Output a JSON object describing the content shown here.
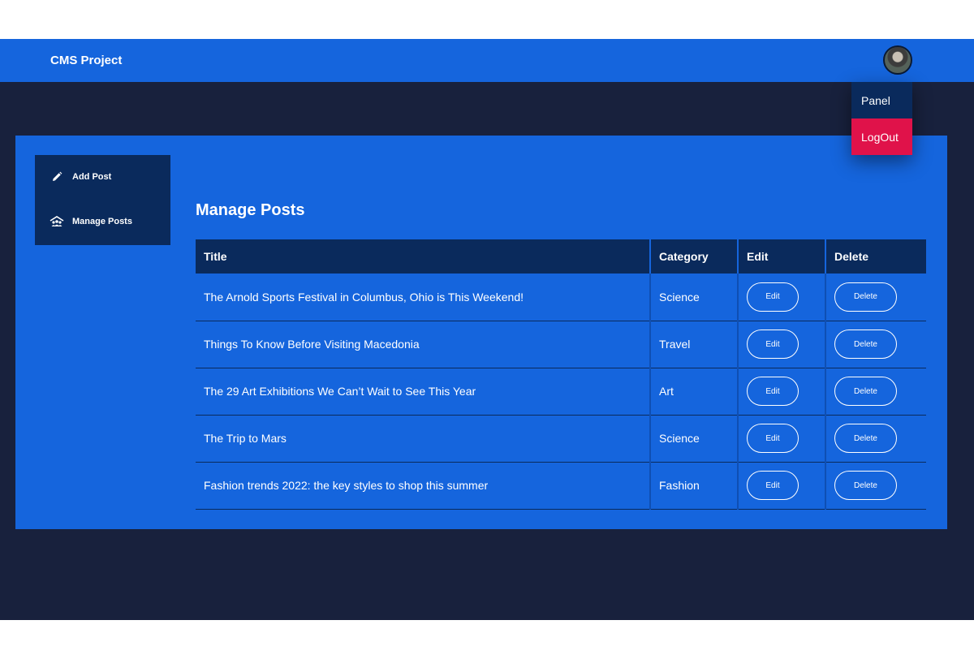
{
  "navbar": {
    "brand": "CMS Project",
    "avatar_icon": "user-avatar-icon"
  },
  "dropdown": {
    "panel_label": "Panel",
    "logout_label": "LogOut"
  },
  "sidebar": {
    "items": [
      {
        "label": "Add Post",
        "icon": "pencil-icon"
      },
      {
        "label": "Manage Posts",
        "icon": "manage-posts-icon"
      }
    ]
  },
  "main": {
    "heading": "Manage Posts",
    "table": {
      "headers": [
        "Title",
        "Category",
        "Edit",
        "Delete"
      ],
      "rows": [
        {
          "title": "The Arnold Sports Festival in Columbus, Ohio is This Weekend!",
          "category": "Science",
          "edit": "Edit",
          "delete": "Delete"
        },
        {
          "title": "Things To Know Before Visiting Macedonia",
          "category": "Travel",
          "edit": "Edit",
          "delete": "Delete"
        },
        {
          "title": "The 29 Art Exhibitions We Can’t Wait to See This Year",
          "category": "Art",
          "edit": "Edit",
          "delete": "Delete"
        },
        {
          "title": "The Trip to Mars",
          "category": "Science",
          "edit": "Edit",
          "delete": "Delete"
        },
        {
          "title": "Fashion trends 2022: the key styles to shop this summer",
          "category": "Fashion",
          "edit": "Edit",
          "delete": "Delete"
        }
      ]
    }
  },
  "colors": {
    "primary": "#1565dd",
    "navy": "#0a2a5c",
    "background": "#18213d",
    "logout": "#e0124a"
  }
}
